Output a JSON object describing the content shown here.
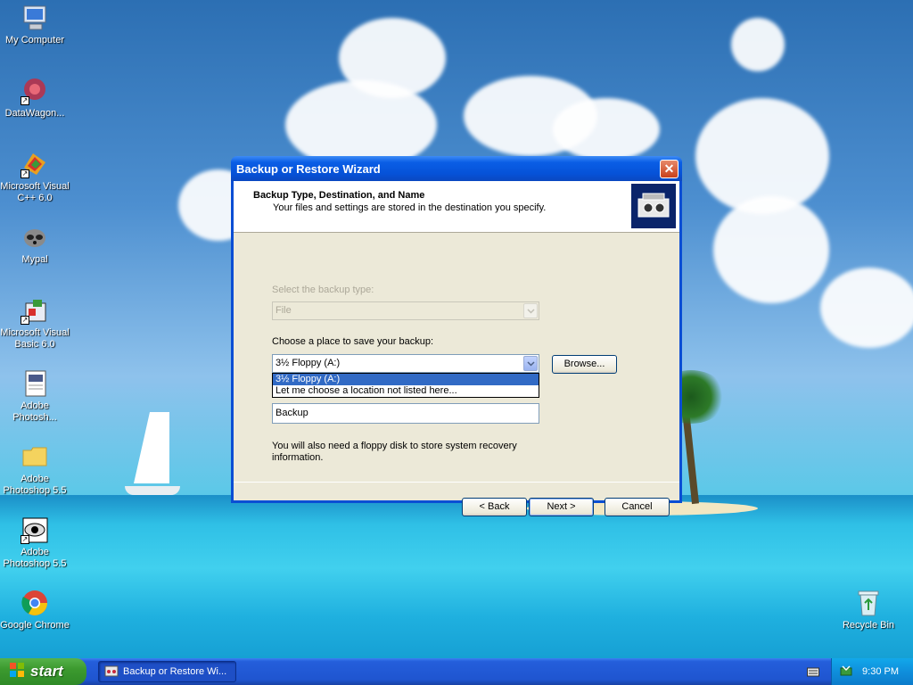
{
  "desktop": {
    "icons": [
      {
        "label": "My Computer"
      },
      {
        "label": "DataWagon..."
      },
      {
        "label": "Microsoft Visual C++ 6.0"
      },
      {
        "label": "Mypal"
      },
      {
        "label": "Microsoft Visual Basic 6.0"
      },
      {
        "label": "Adobe Photosh..."
      },
      {
        "label": "Adobe Photoshop 5.5"
      },
      {
        "label": "Adobe Photoshop 5.5"
      },
      {
        "label": "Google Chrome"
      },
      {
        "label": "Recycle Bin"
      }
    ]
  },
  "wizard": {
    "title": "Backup or Restore Wizard",
    "close_glyph": "✕",
    "header_title": "Backup Type, Destination, and Name",
    "header_subtitle": "Your files and settings are stored in the destination you specify.",
    "backup_type_label": "Select the backup type:",
    "backup_type_value": "File",
    "place_label": "Choose a place to save your backup:",
    "place_value": "3½ Floppy (A:)",
    "place_options": [
      "3½ Floppy (A:)",
      "Let me choose a location not listed here..."
    ],
    "name_value": "Backup",
    "browse_label": "Browse...",
    "note": "You will also need a floppy disk to store system recovery information.",
    "back_label": "< Back",
    "next_label": "Next >",
    "cancel_label": "Cancel"
  },
  "taskbar": {
    "start_label": "start",
    "task_label": "Backup or Restore Wi...",
    "clock": "9:30 PM"
  },
  "colors": {
    "xp_blue": "#0a4ed4",
    "selection": "#316ac5",
    "start_green": "#3c9a2f"
  }
}
